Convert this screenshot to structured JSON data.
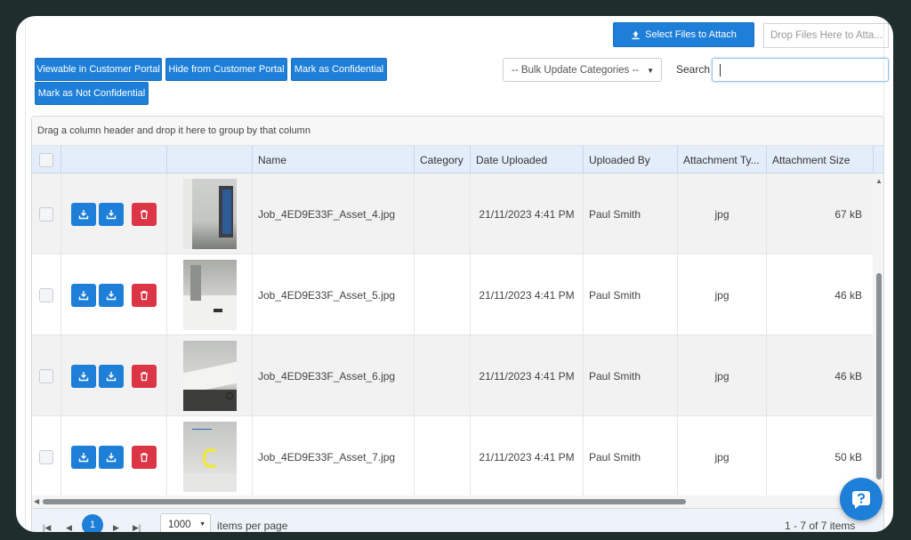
{
  "toolbar": {
    "select_files_label": "Select Files to Attach",
    "drop_zone_text": "Drop Files Here to Atta...",
    "viewable_label": "Viewable in Customer Portal",
    "hide_label": "Hide from Customer Portal",
    "confidential_label": "Mark as Confidential",
    "not_confidential_label": "Mark as Not Confidential",
    "bulk_select_value": "-- Bulk Update Categories --",
    "search_label": "Search",
    "search_value": ""
  },
  "grid": {
    "group_hint": "Drag a column header and drop it here to group by that column",
    "columns": [
      "",
      "",
      "",
      "Name",
      "Category",
      "Date Uploaded",
      "Uploaded By",
      "Attachment Ty...",
      "Attachment Size"
    ],
    "rows": [
      {
        "name": "Job_4ED9E33F_Asset_4.jpg",
        "category": "",
        "date": "21/11/2023 4:41 PM",
        "by": "Paul Smith",
        "type": "jpg",
        "size": "67 kB"
      },
      {
        "name": "Job_4ED9E33F_Asset_5.jpg",
        "category": "",
        "date": "21/11/2023 4:41 PM",
        "by": "Paul Smith",
        "type": "jpg",
        "size": "46 kB"
      },
      {
        "name": "Job_4ED9E33F_Asset_6.jpg",
        "category": "",
        "date": "21/11/2023 4:41 PM",
        "by": "Paul Smith",
        "type": "jpg",
        "size": "46 kB"
      },
      {
        "name": "Job_4ED9E33F_Asset_7.jpg",
        "category": "",
        "date": "21/11/2023 4:41 PM",
        "by": "Paul Smith",
        "type": "jpg",
        "size": "50 kB"
      }
    ]
  },
  "pager": {
    "current_page": "1",
    "page_size": "1000",
    "items_per_page_label": "items per page",
    "info": "1 - 7 of 7 items"
  },
  "icons": {
    "download": "download-icon",
    "delete": "trash-icon",
    "upload": "upload-icon",
    "help": "chat-help-icon"
  },
  "colors": {
    "primary": "#1e7fd8",
    "danger": "#dc3545",
    "header_bg": "#e4eefa"
  }
}
